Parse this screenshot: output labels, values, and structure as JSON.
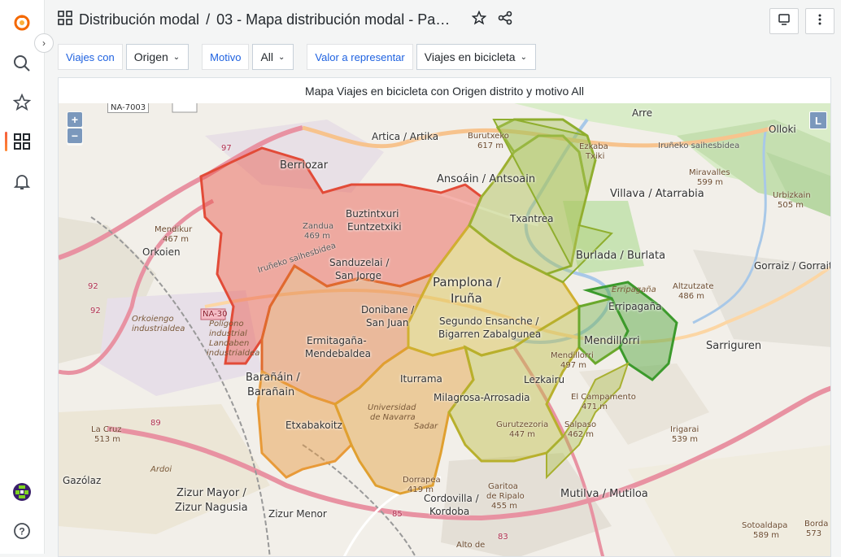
{
  "nav": {
    "collapse_glyph": "›"
  },
  "header": {
    "folder": "Distribución modal",
    "separator": "/",
    "dashboard_title": "03 - Mapa distribución modal - Pamp..."
  },
  "variables": [
    {
      "label": "Viajes con",
      "value": "Origen"
    },
    {
      "label": "Motivo",
      "value": "All"
    },
    {
      "label": "Valor a representar",
      "value": "Viajes en bicicleta"
    }
  ],
  "panel": {
    "title": "Mapa Viajes en bicicleta con Origen distrito y motivo All"
  },
  "map": {
    "zoom_in": "+",
    "zoom_out": "−",
    "layer_button": "L",
    "labels": {
      "na7003": "NA-7003",
      "arre": "Arre",
      "olloki": "Olloki",
      "artica": "Artica / Artika",
      "burutxeko": "Burutxeko",
      "burutxeko_h": "617 m",
      "ezkaba": "Ezkaba",
      "txiki": "Txiki",
      "irunek_1": "Iruñeko saihesbidea",
      "berriozar": "Berriozar",
      "ansoain": "Ansoáin / Antsoain",
      "villava": "Villava / Atarrabia",
      "miravalles": "Miravalles",
      "miravalles_h": "599 m",
      "urbizkain": "Urbizkain",
      "urbizkain_h": "505 m",
      "zandua": "Zandua",
      "zandua_h": "469 m",
      "buztintxuri": "Buztintxuri",
      "euntzetxiki": "Euntzetxiki",
      "txantrea": "Txantrea",
      "mendikur": "Mendikur",
      "mendikur_h": "467 m",
      "orkoien": "Orkoien",
      "irunek_2": "Iruñeko saihesbidea",
      "sanduzelai": "Sanduzelai /",
      "sanjorge": "San Jorge",
      "burlada": "Burlada / Burlata",
      "gorraiz": "Gorraiz / Gorraitz",
      "pamplona": "Pamplona /",
      "iruna": "Iruña",
      "erripagana_i": "Erripagaña",
      "altzutzate": "Altzutzate",
      "altzutzate_h": "486 m",
      "erripagana": "Erripagaña",
      "orkoiengo": "Orkoiengo",
      "industrialdea": "industrialdea",
      "poligono": "Polígono",
      "industrial": "industrial",
      "landaben": "Landaben",
      "industrialdea2": "industrialdea",
      "donibane": "Donibane /",
      "sanjuan": "San Juan",
      "segundo": "Segundo Ensanche /",
      "bigarren": "Bigarren Zabalguneа",
      "mendillorri": "Mendillorri",
      "sarriguren": "Sarriguren",
      "ermitagana": "Ermitagaña-",
      "mendebaldea": "Mendebaldea",
      "mendillorri_h": "Mendillorri",
      "mendillorri_m": "497 m",
      "baranain": "Barañáin /",
      "baranain2": "Barañain",
      "iturrama": "Iturrama",
      "lezkairu": "Lezkairu",
      "milagrosa": "Milagrosa-Arrosadia",
      "campamento": "El Campamento",
      "campamento_h": "471 m",
      "universidad": "Universidad",
      "denavarra": "de Navarra",
      "sadar": "Sadar",
      "irigarai": "Irigarai",
      "irigarai_h": "539 m",
      "lacruz": "La Cruz",
      "lacruz_h": "513 m",
      "etxabakoitz": "Etxabakoitz",
      "gurutzezoria": "Gurutzezoria",
      "gurutzezoria_h": "447 m",
      "salpaso": "Salpaso",
      "salpaso_h": "462 m",
      "ardoi": "Ardoi",
      "gazolaz": "Gazólaz",
      "dorrapea": "Dorrapea",
      "dorrapea_h": "419 m",
      "garitoa": "Garitoa",
      "deripalo": "de Ripalo",
      "deripalo_h": "455 m",
      "zizurmayor": "Zizur Mayor /",
      "zizurnagusia": "Zizur Nagusia",
      "mutilva": "Mutilva / Mutiloa",
      "cordovilla": "Cordovilla /",
      "kordoba": "Kordoba",
      "zizurmenor": "Zizur Menor",
      "altodelpe": "Alto de",
      "sotoaldapa": "Sotoaldapa",
      "sotoaldapa_h": "589 m",
      "borda": "Borda",
      "borda_h": "573",
      "r97": "97",
      "r92": "92",
      "r92b": "92",
      "r89": "89",
      "r85": "85",
      "r83": "83",
      "na30": "NA-30"
    }
  }
}
